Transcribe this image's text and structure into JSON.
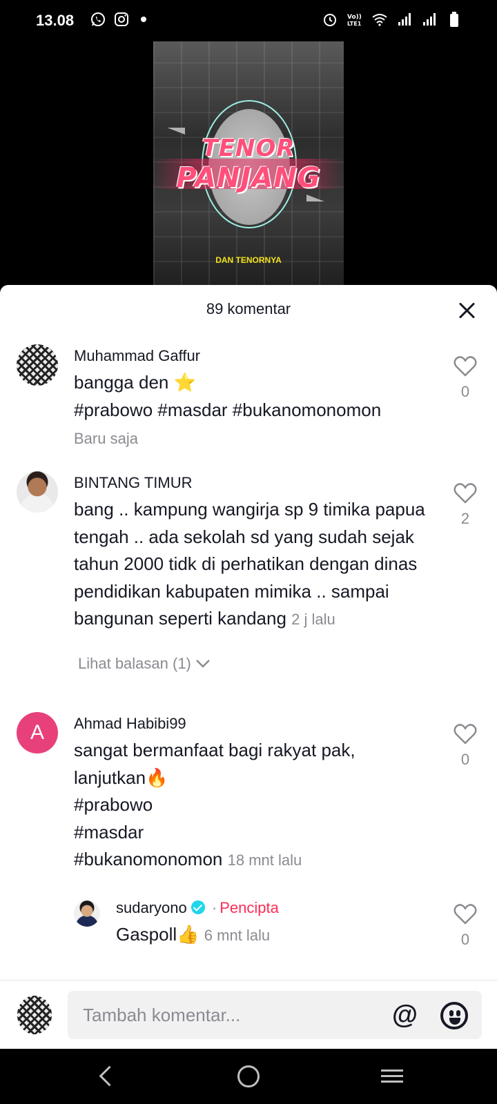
{
  "status_bar": {
    "time": "13.08",
    "left_icons": [
      "whatsapp-icon",
      "instagram-icon",
      "dot-icon"
    ],
    "right_icons": [
      "alarm-icon",
      "volte-icon",
      "wifi-icon",
      "signal-icon",
      "signal-icon",
      "battery-icon"
    ],
    "volte_label": "Vo)) LTE1"
  },
  "video": {
    "title_line1": "TENOR",
    "title_line2": "PANJANG",
    "caption": "DAN TENORNYA"
  },
  "comments_sheet": {
    "title": "89 komentar",
    "close_icon": "close-icon",
    "comments": [
      {
        "username": "Muhammad Gaffur",
        "text_line1": "bangga den ⭐",
        "text_line2": "#prabowo #masdar #bukanomonomon",
        "time": "Baru saja",
        "likes": "0"
      },
      {
        "username": "BINTANG TIMUR",
        "text": "bang .. kampung wangirja sp 9 timika papua tengah .. ada sekolah sd yang sudah sejak tahun 2000 tidk di perhatikan dengan dinas pendidikan kabupaten mimika .. sampai bangunan seperti kandang",
        "time": "2 j lalu",
        "likes": "2",
        "replies_label": "Lihat balasan (1)"
      },
      {
        "username": "Ahmad Habibi99",
        "avatar_letter": "A",
        "text_line1": "sangat bermanfaat bagi rakyat pak,",
        "text_line2": "lanjutkan🔥",
        "text_line3": "#prabowo",
        "text_line4": "#masdar",
        "text_line5": "#bukanomonomon",
        "time": "18 mnt lalu",
        "likes": "0"
      }
    ],
    "reply": {
      "username": "sudaryono",
      "separator": "·",
      "creator_label": "Pencipta",
      "text": "Gaspoll👍",
      "time": "6 mnt lalu",
      "likes": "0"
    }
  },
  "input_bar": {
    "placeholder": "Tambah komentar...",
    "mention_icon": "@"
  },
  "nav_bar": {
    "buttons": [
      "back-icon",
      "home-icon",
      "recents-icon"
    ]
  },
  "colors": {
    "accent": "#fe2c55",
    "verified": "#20d5ec",
    "letter_avatar": "#e8407a",
    "muted_text": "#8a8b91"
  }
}
